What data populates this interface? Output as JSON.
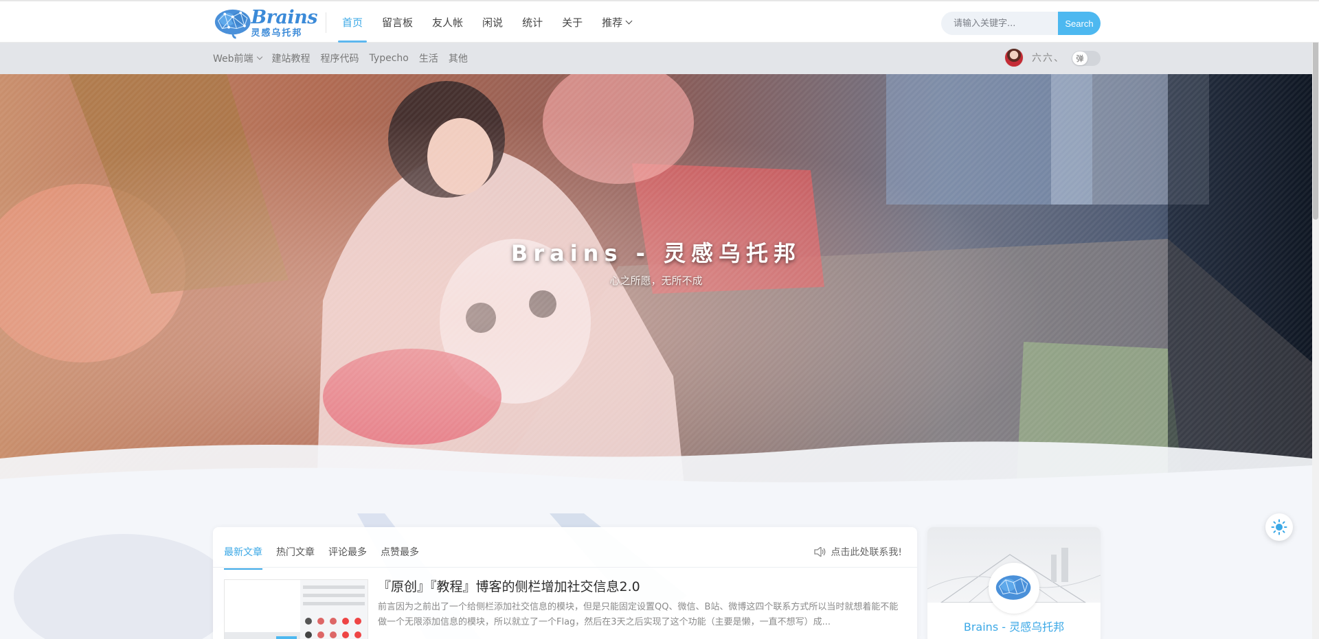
{
  "brand": {
    "name_en": "Brains",
    "name_cn": "灵感乌托邦"
  },
  "nav": {
    "items": [
      {
        "label": "首页",
        "active": true
      },
      {
        "label": "留言板"
      },
      {
        "label": "友人帐"
      },
      {
        "label": "闲说"
      },
      {
        "label": "统计"
      },
      {
        "label": "关于"
      },
      {
        "label": "推荐",
        "dropdown": true
      }
    ]
  },
  "search": {
    "placeholder": "请输入关键字...",
    "button_label": "Search"
  },
  "categories": [
    {
      "label": "Web前端",
      "dropdown": true
    },
    {
      "label": "建站教程"
    },
    {
      "label": "程序代码"
    },
    {
      "label": "Typecho"
    },
    {
      "label": "生活"
    },
    {
      "label": "其他"
    }
  ],
  "user": {
    "name": "六六、",
    "toggle_label": "弹"
  },
  "hero": {
    "title": "Brains - 灵感乌托邦",
    "subtitle": "心之所愿，无所不成"
  },
  "tabs": [
    {
      "label": "最新文章",
      "active": true
    },
    {
      "label": "热门文章"
    },
    {
      "label": "评论最多"
    },
    {
      "label": "点赞最多"
    }
  ],
  "contact_text": "点击此处联系我!",
  "post": {
    "title": "『原创』『教程』博客的侧栏增加社交信息2.0",
    "excerpt": "前言因为之前出了一个给侧栏添加社交信息的模块，但是只能固定设置QQ、微信、B站、微博这四个联系方式所以当时就想着能不能做一个无限添加信息的模块，所以就立了一个Flag，然后在3天之后实现了这个功能（主要是懒，一直不想写）成..."
  },
  "sidebar": {
    "site_name": "Brains - 灵感乌托邦"
  },
  "colors": {
    "accent": "#3ba8e6",
    "search_button": "#4db8f0",
    "brand_blue": "#3b8ad8"
  },
  "icons": [
    "brain-logo-icon",
    "chevron-down-icon",
    "speaker-icon",
    "sun-icon"
  ]
}
